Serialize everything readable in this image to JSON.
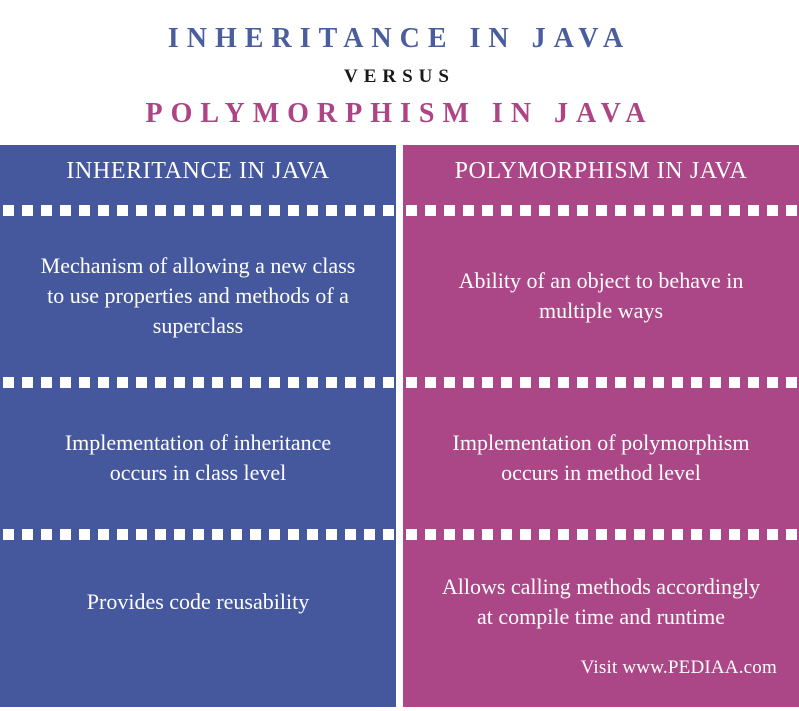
{
  "title": {
    "line1": "INHERITANCE IN JAVA",
    "line2": "VERSUS",
    "line3": "POLYMORPHISM IN JAVA"
  },
  "colors": {
    "left_panel": "#45589e",
    "right_panel": "#ab4786",
    "title_left": "#4a5e9e",
    "title_right": "#ad4585",
    "versus": "#1a1a1a",
    "text": "#ffffff",
    "background": "#ffffff"
  },
  "comparison": {
    "columns": [
      {
        "header": "INHERITANCE IN JAVA",
        "rows": [
          "Mechanism of allowing a new class to use properties and methods of a superclass",
          "Implementation of inheritance occurs in class level",
          "Provides code reusability"
        ]
      },
      {
        "header": "POLYMORPHISM IN JAVA",
        "rows": [
          "Ability of an object to behave in multiple ways",
          "Implementation of polymorphism occurs in method level",
          "Allows calling methods accordingly at compile time and runtime"
        ]
      }
    ]
  },
  "footer": {
    "credit": "Visit www.PEDIAA.com"
  }
}
